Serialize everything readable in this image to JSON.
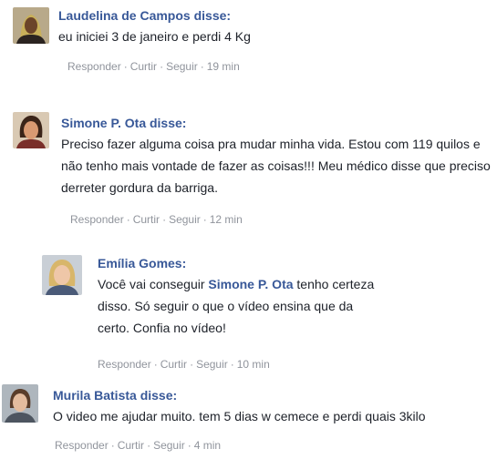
{
  "comments": [
    {
      "author": "Laudelina de Campos disse:",
      "text": "eu iniciei 3 de janeiro e perdi 4 Kg",
      "reply": "Responder",
      "like": "Curtir",
      "follow": "Seguir",
      "time": "19 min"
    },
    {
      "author": "Simone P. Ota disse:",
      "text": "Preciso fazer alguma coisa pra mudar minha vida. Estou com 119 quilos e não tenho mais vontade de fazer as coisas!!! Meu médico disse que preciso derreter gordura da barriga.",
      "reply": "Responder",
      "like": "Curtir",
      "follow": "Seguir",
      "time": "12 min"
    },
    {
      "author": "Emília Gomes:",
      "text_before": "Você vai conseguir ",
      "mention": "Simone P. Ota",
      "text_after": " tenho certeza disso. Só seguir o que o vídeo ensina que da certo. Confia no vídeo!",
      "reply": "Responder",
      "like": "Curtir",
      "follow": "Seguir",
      "time": "10 min"
    },
    {
      "author": "Murila Batista disse:",
      "text": "O video me ajudar muito. tem 5 dias w cemece e perdi quais 3kilo",
      "reply": "Responder",
      "like": "Curtir",
      "follow": "Seguir",
      "time": "4 min"
    }
  ],
  "separator": "·",
  "colors": {
    "author": "#385898",
    "text": "#1d2129",
    "meta": "#90949c"
  }
}
